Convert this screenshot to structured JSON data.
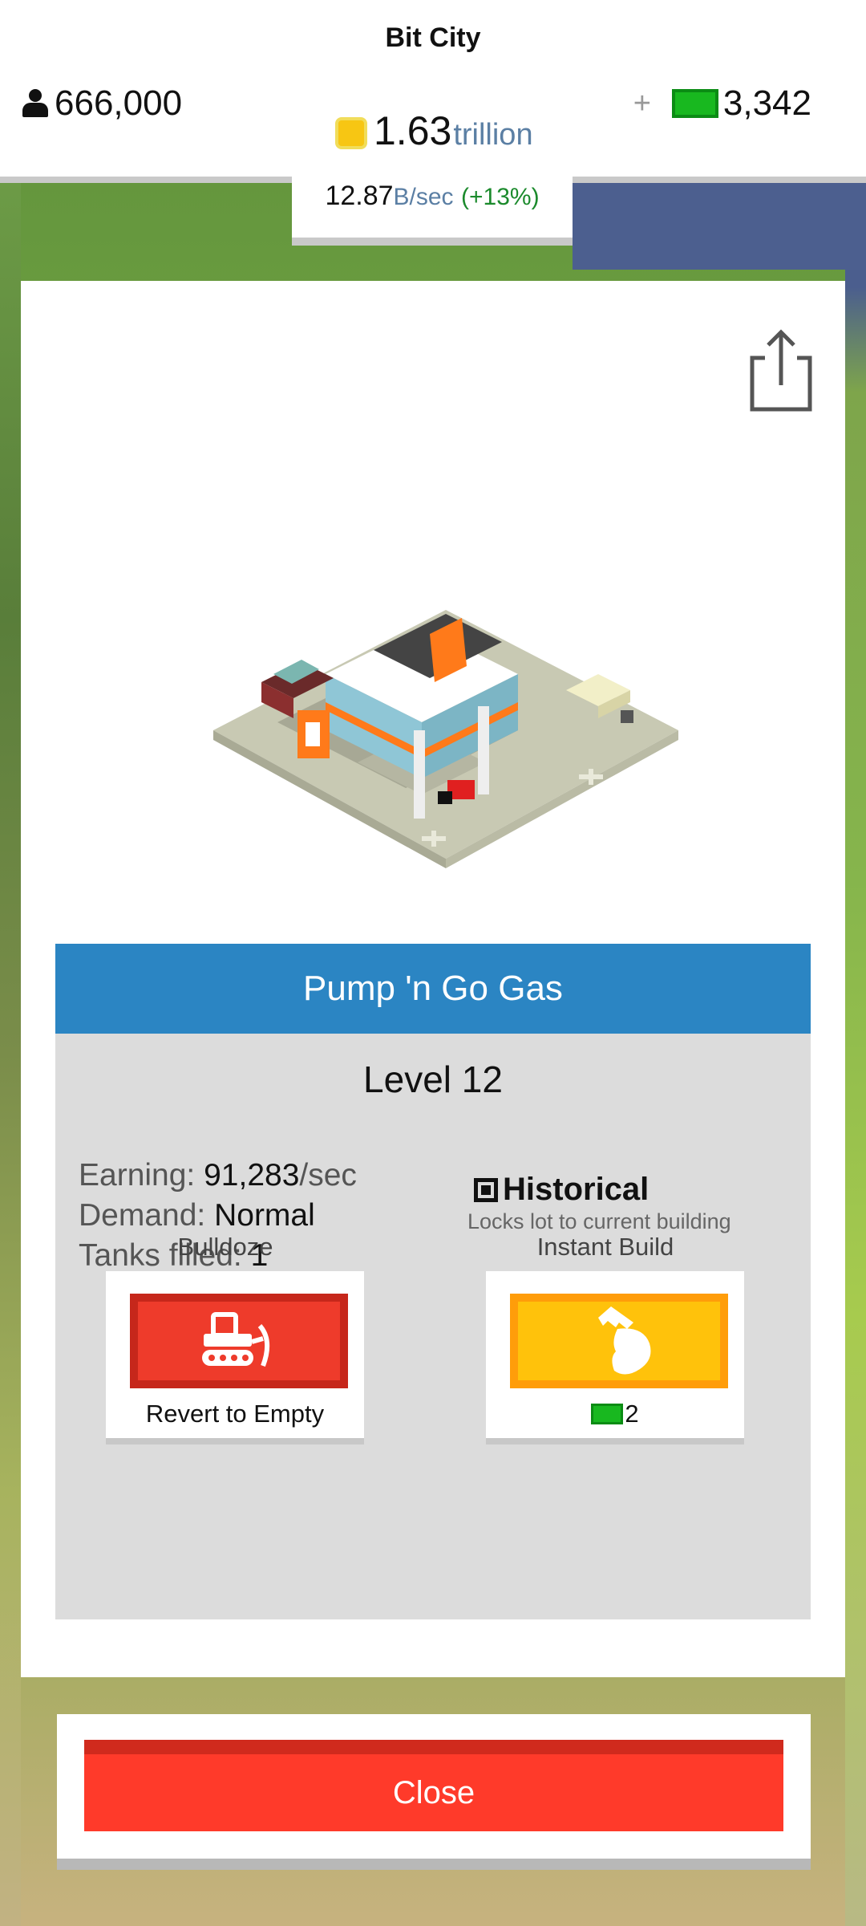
{
  "header": {
    "city_name": "Bit City",
    "population": "666,000",
    "coins_value": "1.63",
    "coins_unit": "trillion",
    "plus_label": "+",
    "cash": "3,342",
    "rate_value": "12.87",
    "rate_unit": "B/sec",
    "rate_change": "(+13%)"
  },
  "building": {
    "name": "Pump 'n Go Gas",
    "level": "Level 12",
    "stats": [
      {
        "label": "Earning: ",
        "value": "91,283",
        "suffix": "/sec"
      },
      {
        "label": "Demand: ",
        "value": "Normal",
        "suffix": ""
      },
      {
        "label": "Tanks filled: ",
        "value": "1",
        "suffix": ""
      }
    ],
    "historical_label": "Historical",
    "historical_desc": "Locks lot to current building"
  },
  "actions": {
    "bulldoze_label": "Bulldoze",
    "bulldoze_caption": "Revert to Empty",
    "instant_build_label": "Instant Build",
    "instant_build_cost": "2"
  },
  "close_label": "Close",
  "colors": {
    "title_bar": "#2b85c3",
    "bulldoze": "#ee3b2b",
    "instant_build": "#ffc20b",
    "close": "#ff3a2a",
    "cash": "#18b81f"
  },
  "icons": [
    "person-icon",
    "coin-icon",
    "cash-icon",
    "share-icon",
    "bulldozer-icon",
    "hammer-hand-icon"
  ]
}
